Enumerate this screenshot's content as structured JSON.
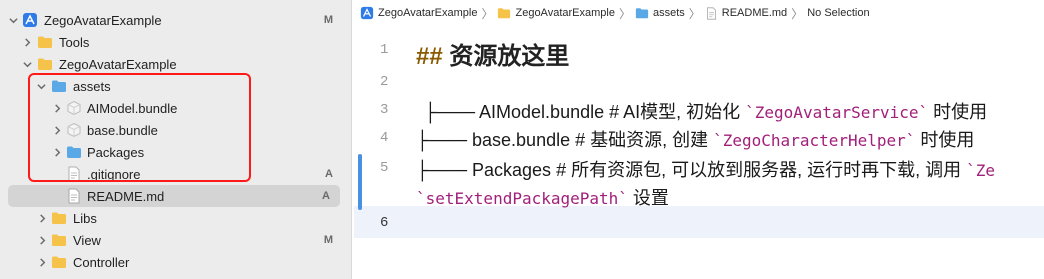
{
  "sidebar": {
    "items": [
      {
        "label": "ZegoAvatarExample",
        "badge": "M"
      },
      {
        "label": "Tools",
        "badge": ""
      },
      {
        "label": "ZegoAvatarExample",
        "badge": ""
      },
      {
        "label": "assets",
        "badge": ""
      },
      {
        "label": "AIModel.bundle",
        "badge": ""
      },
      {
        "label": "base.bundle",
        "badge": ""
      },
      {
        "label": "Packages",
        "badge": ""
      },
      {
        "label": ".gitignore",
        "badge": "A"
      },
      {
        "label": "README.md",
        "badge": "A"
      },
      {
        "label": "Libs",
        "badge": ""
      },
      {
        "label": "View",
        "badge": "M"
      },
      {
        "label": "Controller",
        "badge": ""
      }
    ]
  },
  "jumpbar": {
    "crumbs": [
      "ZegoAvatarExample",
      "ZegoAvatarExample",
      "assets",
      "README.md",
      "No Selection"
    ]
  },
  "editor": {
    "line_numbers": [
      "1",
      "2",
      "3",
      "4",
      "5",
      "6"
    ],
    "line1": {
      "hash": "##",
      "text": " 资源放这里"
    },
    "line3": {
      "pre": "├─── AIModel.bundle  # AI模型, 初始化 ",
      "code": "`ZegoAvatarService`",
      "post": " 时使用"
    },
    "line4": {
      "pre": "├─── base.bundle     # 基础资源, 创建 ",
      "code": "`ZegoCharacterHelper`",
      "post": " 时使用"
    },
    "line5": {
      "pre": "├─── Packages        # 所有资源包, 可以放到服务器, 运行时再下载, 调用 ",
      "code": "`Ze"
    },
    "line5b": {
      "code": "`setExtendPackagePath`",
      "post": " 设置"
    }
  },
  "colors": {
    "folder": "#5aa9e6",
    "folder_yellow": "#f5c24a",
    "highlight_box": "#ff1a1a",
    "gutter_mark": "#4a90e2"
  }
}
